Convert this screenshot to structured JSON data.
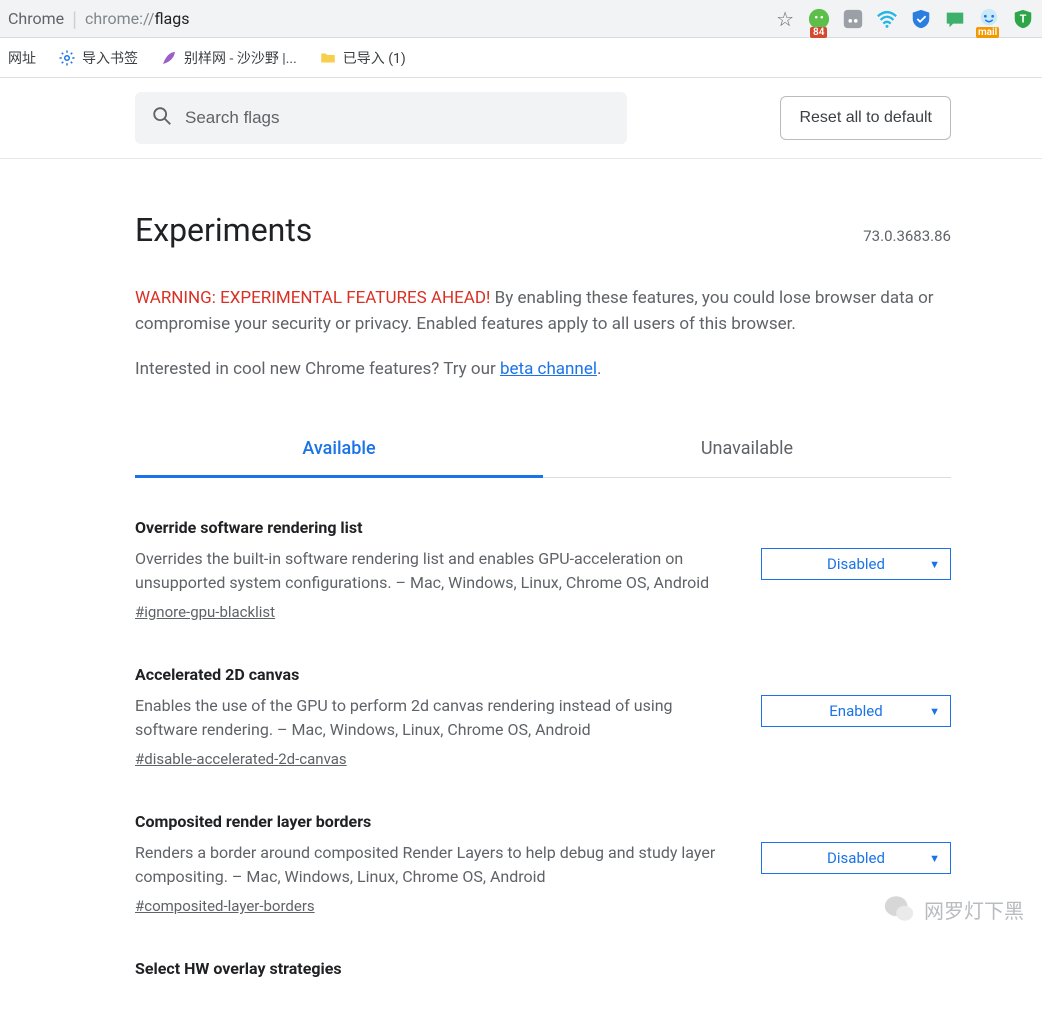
{
  "addressbar": {
    "prefix": "Chrome",
    "separator": "|",
    "scheme": "chrome://",
    "path": "flags"
  },
  "extension_badges": {
    "wechat_count": "84",
    "mail_label": "mail"
  },
  "bookmarks": {
    "item0": "网址",
    "item1": "导入书签",
    "item2": "别样网 - 沙沙野 |...",
    "item3": "已导入 (1)"
  },
  "toolbar": {
    "search_placeholder": "Search flags",
    "reset_label": "Reset all to default"
  },
  "header": {
    "title": "Experiments",
    "version": "73.0.3683.86"
  },
  "warning": {
    "red": "WARNING: EXPERIMENTAL FEATURES AHEAD!",
    "body": " By enabling these features, you could lose browser data or compromise your security or privacy. Enabled features apply to all users of this browser.",
    "beta_pre": "Interested in cool new Chrome features? Try our ",
    "beta_link": "beta channel",
    "beta_post": "."
  },
  "tabs": {
    "available": "Available",
    "unavailable": "Unavailable"
  },
  "flags": [
    {
      "title": "Override software rendering list",
      "desc": "Overrides the built-in software rendering list and enables GPU-acceleration on unsupported system configurations. – Mac, Windows, Linux, Chrome OS, Android",
      "anchor": "#ignore-gpu-blacklist",
      "value": "Disabled"
    },
    {
      "title": "Accelerated 2D canvas",
      "desc": "Enables the use of the GPU to perform 2d canvas rendering instead of using software rendering. – Mac, Windows, Linux, Chrome OS, Android",
      "anchor": "#disable-accelerated-2d-canvas",
      "value": "Enabled"
    },
    {
      "title": "Composited render layer borders",
      "desc": "Renders a border around composited Render Layers to help debug and study layer compositing. – Mac, Windows, Linux, Chrome OS, Android",
      "anchor": "#composited-layer-borders",
      "value": "Disabled"
    },
    {
      "title": "Select HW overlay strategies",
      "desc": "",
      "anchor": "",
      "value": ""
    }
  ],
  "watermark": {
    "text": "网罗灯下黑"
  }
}
